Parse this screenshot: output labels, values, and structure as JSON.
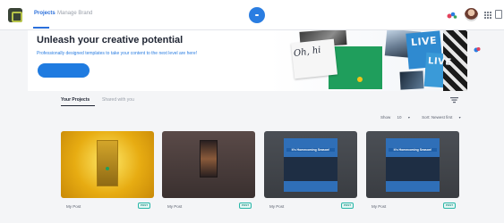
{
  "header": {
    "tabs": [
      {
        "label": "Projects",
        "active": true
      },
      {
        "label": "Manage Brand",
        "active": false
      }
    ]
  },
  "hero": {
    "title": "Unleash your creative potential",
    "subtitle": "Professionally designed templates to take your content to the next level are here!",
    "brush_text": "Oh, hi",
    "poster_text_1": "LIVE",
    "poster_text_2": "LIVE"
  },
  "projects": {
    "tabs": [
      {
        "label": "Your Projects",
        "active": true
      },
      {
        "label": "Shared with you",
        "active": false
      }
    ],
    "show_label": "Show",
    "show_value": "10",
    "sort_label": "Sort: Newest first",
    "cards": [
      {
        "title": "My Post",
        "badge": "POST",
        "thumb_text": ""
      },
      {
        "title": "My Post",
        "badge": "POST",
        "thumb_text": ""
      },
      {
        "title": "My Post",
        "badge": "POST",
        "thumb_text": "It's Homecoming Season!"
      },
      {
        "title": "My Post",
        "badge": "POST",
        "thumb_text": "It's Homecoming Season!"
      }
    ]
  },
  "colors": {
    "accent": "#2a7de1",
    "badge": "#29b6a8",
    "hero_green": "#1f9e5c"
  }
}
